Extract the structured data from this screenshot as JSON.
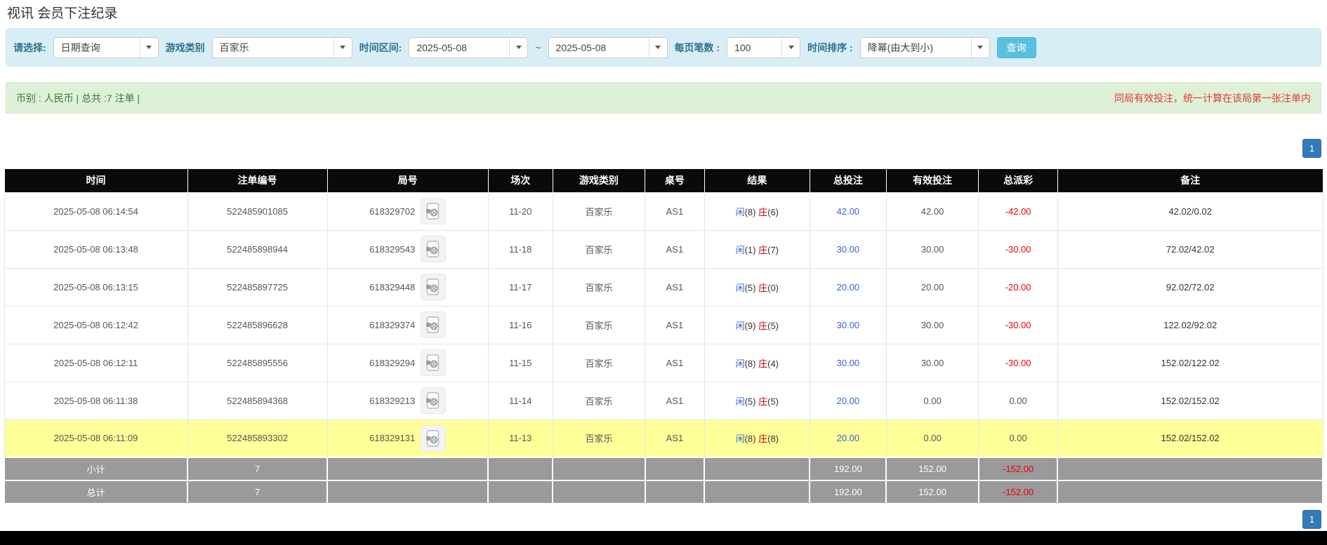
{
  "page_title": "视讯 会员下注纪录",
  "colors": {
    "accent_blue": "#337ab7",
    "button_cyan": "#5bc0de",
    "highlight_yellow": "#ffff99",
    "summary_green_bg": "#dff0d8",
    "notice_red": "#e4392e",
    "header_black": "#0a0a0a",
    "footer_gray": "#9a9a9a",
    "link_blue": "#3366cc",
    "loss_red": "#f00000"
  },
  "icons": {
    "dropdown": "caret-down-icon",
    "round_video": "video-record-icon"
  },
  "filters": {
    "query_type_label": "请选择:",
    "query_type_value": "日期查询",
    "game_category_label": "游戏类别",
    "game_category_value": "百家乐",
    "time_range_label": "时间区间:",
    "date_from": "2025-05-08",
    "range_separator": "~",
    "date_to": "2025-05-08",
    "page_size_label": "每页笔数 :",
    "page_size_value": "100",
    "sort_label": "时间排序 :",
    "sort_value": "降幂(由大到小)",
    "search_button": "查询"
  },
  "summary": {
    "left_text": "币别 : 人民币 | 总共 :7 注单 |",
    "right_notice": "同局有效投注，统一计算在该局第一张注单内"
  },
  "pagination": {
    "page": "1"
  },
  "table": {
    "headers": [
      "时间",
      "注单编号",
      "局号",
      "场次",
      "游戏类别",
      "桌号",
      "结果",
      "总投注",
      "有效投注",
      "总派彩",
      "备注"
    ],
    "rows": [
      {
        "time": "2025-05-08 06:14:54",
        "bet_id": "522485901085",
        "round_id": "618329702",
        "session": "11-20",
        "game": "百家乐",
        "table_no": "AS1",
        "player": "闲",
        "player_num": "(8)",
        "banker": "庄",
        "banker_num": "(6)",
        "total_bet": "42.00",
        "valid_bet": "42.00",
        "payout": "-42.00",
        "remark": "42.02/0.02",
        "highlighted": false
      },
      {
        "time": "2025-05-08 06:13:48",
        "bet_id": "522485898944",
        "round_id": "618329543",
        "session": "11-18",
        "game": "百家乐",
        "table_no": "AS1",
        "player": "闲",
        "player_num": "(1)",
        "banker": "庄",
        "banker_num": "(7)",
        "total_bet": "30.00",
        "valid_bet": "30.00",
        "payout": "-30.00",
        "remark": "72.02/42.02",
        "highlighted": false
      },
      {
        "time": "2025-05-08 06:13:15",
        "bet_id": "522485897725",
        "round_id": "618329448",
        "session": "11-17",
        "game": "百家乐",
        "table_no": "AS1",
        "player": "闲",
        "player_num": "(5)",
        "banker": "庄",
        "banker_num": "(0)",
        "total_bet": "20.00",
        "valid_bet": "20.00",
        "payout": "-20.00",
        "remark": "92.02/72.02",
        "highlighted": false
      },
      {
        "time": "2025-05-08 06:12:42",
        "bet_id": "522485896628",
        "round_id": "618329374",
        "session": "11-16",
        "game": "百家乐",
        "table_no": "AS1",
        "player": "闲",
        "player_num": "(9)",
        "banker": "庄",
        "banker_num": "(5)",
        "total_bet": "30.00",
        "valid_bet": "30.00",
        "payout": "-30.00",
        "remark": "122.02/92.02",
        "highlighted": false
      },
      {
        "time": "2025-05-08 06:12:11",
        "bet_id": "522485895556",
        "round_id": "618329294",
        "session": "11-15",
        "game": "百家乐",
        "table_no": "AS1",
        "player": "闲",
        "player_num": "(8)",
        "banker": "庄",
        "banker_num": "(4)",
        "total_bet": "30.00",
        "valid_bet": "30.00",
        "payout": "-30.00",
        "remark": "152.02/122.02",
        "highlighted": false
      },
      {
        "time": "2025-05-08 06:11:38",
        "bet_id": "522485894368",
        "round_id": "618329213",
        "session": "11-14",
        "game": "百家乐",
        "table_no": "AS1",
        "player": "闲",
        "player_num": "(5)",
        "banker": "庄",
        "banker_num": "(5)",
        "total_bet": "20.00",
        "valid_bet": "0.00",
        "payout": "0.00",
        "remark": "152.02/152.02",
        "highlighted": false
      },
      {
        "time": "2025-05-08 06:11:09",
        "bet_id": "522485893302",
        "round_id": "618329131",
        "session": "11-13",
        "game": "百家乐",
        "table_no": "AS1",
        "player": "闲",
        "player_num": "(8)",
        "banker": "庄",
        "banker_num": "(8)",
        "total_bet": "20.00",
        "valid_bet": "0.00",
        "payout": "0.00",
        "remark": "152.02/152.02",
        "highlighted": true
      }
    ],
    "subtotal": {
      "label": "小计",
      "count": "7",
      "total_bet": "192.00",
      "valid_bet": "152.00",
      "payout": "-152.00"
    },
    "total": {
      "label": "总计",
      "count": "7",
      "total_bet": "192.00",
      "valid_bet": "152.00",
      "payout": "-152.00"
    }
  }
}
